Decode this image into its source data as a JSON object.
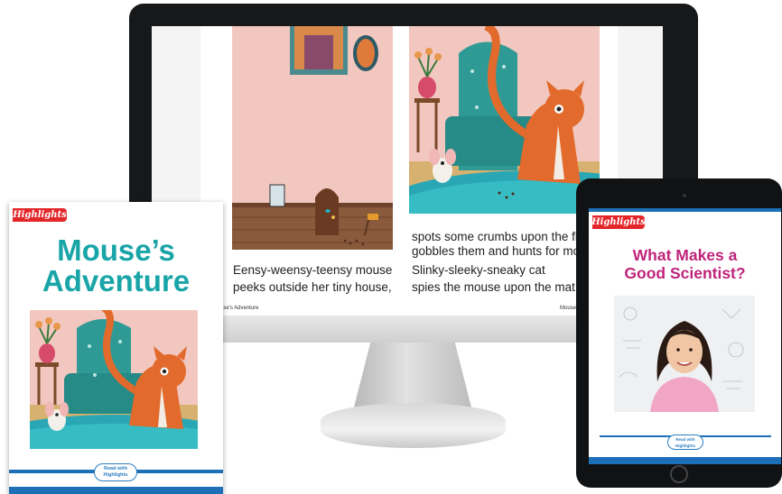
{
  "monitor": {
    "left_page": {
      "line1": "Eensy-weensy-teensy mouse",
      "line2": "peeks outside her tiny house,",
      "footer": "use's Adventure"
    },
    "right_page": {
      "line1": "spots some crumbs upon the fl",
      "line2": "gobbles them and hunts for mo",
      "line3": "Slinky-sleeky-sneaky cat",
      "line4": "spies the mouse upon the mat.",
      "footer": "Mouse's A"
    }
  },
  "book": {
    "logo": "Highlights",
    "title_line1": "Mouse’s",
    "title_line2": "Adventure",
    "badge_line1": "Read with",
    "badge_line2": "Highlights"
  },
  "tablet": {
    "logo": "Highlights",
    "title_line1": "What Makes a",
    "title_line2": "Good Scientist?",
    "badge_line1": "Read with",
    "badge_line2": "Highlights"
  },
  "colors": {
    "brand_red": "#e3262a",
    "book_title": "#19a5a8",
    "tablet_title": "#c0247a",
    "accent_blue": "#1d70b8"
  }
}
